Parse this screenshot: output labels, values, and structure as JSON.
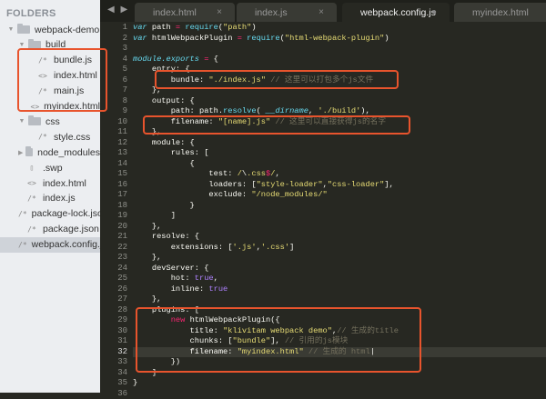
{
  "sidebar": {
    "title": "FOLDERS",
    "items": [
      {
        "label": "webpack-demo",
        "type": "folder",
        "open": true,
        "depth": 0
      },
      {
        "label": "build",
        "type": "folder",
        "open": true,
        "depth": 1
      },
      {
        "label": "bundle.js",
        "type": "js",
        "depth": 2
      },
      {
        "label": "index.html",
        "type": "html",
        "depth": 2
      },
      {
        "label": "main.js",
        "type": "js",
        "depth": 2
      },
      {
        "label": "myindex.html",
        "type": "html",
        "depth": 2
      },
      {
        "label": "css",
        "type": "folder",
        "open": true,
        "depth": 1
      },
      {
        "label": "style.css",
        "type": "js",
        "depth": 2
      },
      {
        "label": "node_modules",
        "type": "folder",
        "open": false,
        "depth": 1
      },
      {
        "label": ".swp",
        "type": "file",
        "depth": 1
      },
      {
        "label": "index.html",
        "type": "html",
        "depth": 1
      },
      {
        "label": "index.js",
        "type": "js",
        "depth": 1
      },
      {
        "label": "package-lock.json",
        "type": "js",
        "depth": 1
      },
      {
        "label": "package.json",
        "type": "js",
        "depth": 1
      },
      {
        "label": "webpack.config.js",
        "type": "js",
        "depth": 1,
        "selected": true
      }
    ]
  },
  "tabs": [
    {
      "label": "index.html",
      "close": "×"
    },
    {
      "label": "index.js",
      "close": "×"
    },
    {
      "label": "webpack.config.js",
      "close": "●",
      "active": true
    },
    {
      "label": "myindex.html",
      "close": ""
    }
  ],
  "nav": "◀ ▶",
  "current_line": 32,
  "code": [
    [
      [
        "kw",
        "var"
      ],
      [
        "pl",
        " path "
      ],
      [
        "op",
        "="
      ],
      [
        "pl",
        " "
      ],
      [
        "fn",
        "require"
      ],
      [
        "pl",
        "("
      ],
      [
        "str",
        "\"path\""
      ],
      [
        "pl",
        ")"
      ]
    ],
    [
      [
        "kw",
        "var"
      ],
      [
        "pl",
        " htmlWebpackPlugin "
      ],
      [
        "op",
        "="
      ],
      [
        "pl",
        " "
      ],
      [
        "fn",
        "require"
      ],
      [
        "pl",
        "("
      ],
      [
        "str",
        "\"html-webpack-plugin\""
      ],
      [
        "pl",
        ")"
      ]
    ],
    [],
    [
      [
        "it",
        "module.exports"
      ],
      [
        "pl",
        " "
      ],
      [
        "op",
        "="
      ],
      [
        "pl",
        " {"
      ]
    ],
    [
      [
        "pl",
        "    entry: {"
      ]
    ],
    [
      [
        "pl",
        "        bundle: "
      ],
      [
        "str",
        "\"./index.js\""
      ],
      [
        "pl",
        " "
      ],
      [
        "cm",
        "// 这里可以打包多个js文件"
      ]
    ],
    [
      [
        "pl",
        "    },"
      ]
    ],
    [
      [
        "pl",
        "    output: {"
      ]
    ],
    [
      [
        "pl",
        "        path: path."
      ],
      [
        "fn",
        "resolve"
      ],
      [
        "pl",
        "( "
      ],
      [
        "it",
        "__dirname"
      ],
      [
        "pl",
        ", "
      ],
      [
        "str",
        "'./build'"
      ],
      [
        "pl",
        "),"
      ]
    ],
    [
      [
        "pl",
        "        filename: "
      ],
      [
        "str",
        "\"[name].js\""
      ],
      [
        "pl",
        " "
      ],
      [
        "cm",
        "// 这里可以直接获得js的名字"
      ]
    ],
    [
      [
        "pl",
        "    },"
      ]
    ],
    [
      [
        "pl",
        "    module: {"
      ]
    ],
    [
      [
        "pl",
        "        rules: ["
      ]
    ],
    [
      [
        "pl",
        "            {"
      ]
    ],
    [
      [
        "pl",
        "                test: "
      ],
      [
        "str",
        "/"
      ],
      [
        "pl",
        "\\"
      ],
      [
        "str",
        ".css"
      ],
      [
        "op",
        "$"
      ],
      [
        "str",
        "/"
      ],
      [
        "pl",
        ","
      ]
    ],
    [
      [
        "pl",
        "                loaders: ["
      ],
      [
        "str",
        "\"style-loader\""
      ],
      [
        "pl",
        ","
      ],
      [
        "str",
        "\"css-loader\""
      ],
      [
        "pl",
        "],"
      ]
    ],
    [
      [
        "pl",
        "                exclude: "
      ],
      [
        "str",
        "\"/node_modules/\""
      ]
    ],
    [
      [
        "pl",
        "            }"
      ]
    ],
    [
      [
        "pl",
        "        ]"
      ]
    ],
    [
      [
        "pl",
        "    },"
      ]
    ],
    [
      [
        "pl",
        "    resolve: {"
      ]
    ],
    [
      [
        "pl",
        "        extensions: ["
      ],
      [
        "str",
        "'.js'"
      ],
      [
        "pl",
        ","
      ],
      [
        "str",
        "'.css'"
      ],
      [
        "pl",
        "]"
      ]
    ],
    [
      [
        "pl",
        "    },"
      ]
    ],
    [
      [
        "pl",
        "    devServer: {"
      ]
    ],
    [
      [
        "pl",
        "        hot: "
      ],
      [
        "bool",
        "true"
      ],
      [
        "pl",
        ","
      ]
    ],
    [
      [
        "pl",
        "        inline: "
      ],
      [
        "bool",
        "true"
      ]
    ],
    [
      [
        "pl",
        "    },"
      ]
    ],
    [
      [
        "pl",
        "    plugins: ["
      ]
    ],
    [
      [
        "pl",
        "        "
      ],
      [
        "op",
        "new"
      ],
      [
        "pl",
        " htmlWebpackPlugin({"
      ]
    ],
    [
      [
        "pl",
        "            title: "
      ],
      [
        "str",
        "\"klivitam webpack demo\""
      ],
      [
        "pl",
        ","
      ],
      [
        "cm",
        "// 生成的title"
      ]
    ],
    [
      [
        "pl",
        "            chunks: ["
      ],
      [
        "str",
        "\"bundle\""
      ],
      [
        "pl",
        "], "
      ],
      [
        "cm",
        "// 引用的js模块"
      ]
    ],
    [
      [
        "pl",
        "            filename: "
      ],
      [
        "str",
        "\"myindex.html\""
      ],
      [
        "pl",
        " "
      ],
      [
        "cm",
        "// 生成的 html"
      ],
      [
        "pl",
        "|"
      ]
    ],
    [
      [
        "pl",
        "        })"
      ]
    ],
    [
      [
        "pl",
        "    ]"
      ]
    ],
    [
      [
        "pl",
        "}"
      ]
    ],
    []
  ],
  "colors": {
    "editor_bg": "#272822",
    "sidebar_bg": "#eceef1",
    "highlight_box": "#e8542d"
  }
}
